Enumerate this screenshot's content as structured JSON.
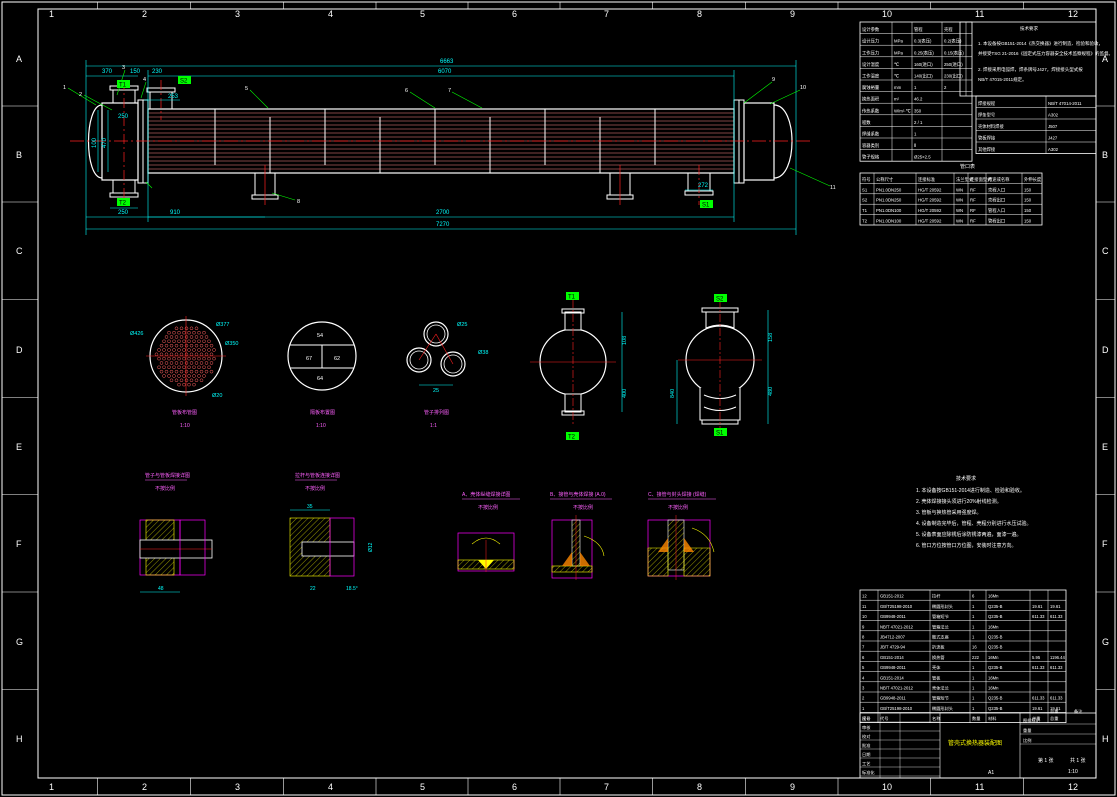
{
  "grid": {
    "columns": [
      "1",
      "2",
      "3",
      "4",
      "5",
      "6",
      "7",
      "8",
      "9",
      "10",
      "11",
      "12"
    ],
    "rows": [
      "A",
      "B",
      "C",
      "D",
      "E",
      "F",
      "G",
      "H"
    ]
  },
  "colors": {
    "background": "#000000",
    "line": "#ffffff",
    "dimension": "#00ffff",
    "centerline": "#ff2020",
    "part": "#ffff00",
    "nozzle_tag": "#00ff00",
    "hatch": "#ff00ff",
    "weld": "#ffff00"
  },
  "nozzles": {
    "t1": "T1",
    "t2": "T2",
    "s1": "S1",
    "s2": "S2"
  },
  "main_view": {
    "dims": {
      "overall_top": "6663",
      "inner_top": "6070",
      "left_a": "370",
      "left_b": "150",
      "left_c": "230",
      "left_d": "253",
      "left_e": "250",
      "height_a": "100",
      "height_b": "470",
      "support": "910",
      "support_span": "2700",
      "overall_bottom": "7270",
      "right_s1": "272"
    },
    "balloons": [
      "1",
      "2",
      "3",
      "4",
      "5",
      "6",
      "7",
      "8",
      "9",
      "10",
      "11"
    ]
  },
  "detail_views": {
    "tubesheet": {
      "caption": "管板布管图",
      "scale": "1:10",
      "d1": "Ø426",
      "d2": "Ø377",
      "d3": "Ø350",
      "d4": "Ø20"
    },
    "passes": {
      "caption": "隔板布置图",
      "scale": "1:10",
      "top": "54",
      "left": "67",
      "right": "62",
      "bottom": "64"
    },
    "tubes": {
      "caption": "管子排列图",
      "scale": "1:1",
      "d1": "Ø25",
      "d2": "Ø38",
      "d3": "25"
    },
    "channel_view": {
      "d1": "108",
      "d2": "400"
    },
    "bonnet_view": {
      "d1": "158",
      "d2": "480",
      "d3": "840"
    }
  },
  "weld_details": {
    "d1": {
      "title": "管子与管板焊接详图",
      "sub": "不按比例",
      "dim": "48"
    },
    "d2": {
      "title": "拉杆与管板连接详图",
      "sub": "不按比例",
      "d1": "35",
      "d2": "Ø12",
      "d3": "18.5°",
      "d4": "22"
    },
    "d3": {
      "title": "A、壳体纵缝焊接详图",
      "sub": "不按比例"
    },
    "d4": {
      "title": "B、接管与壳体焊接 (A.0)",
      "sub": "不按比例"
    },
    "d5": {
      "title": "C、接管与封头焊接 (焊缝)",
      "sub": "不按比例"
    }
  },
  "design_data": {
    "header": [
      "设计参数",
      "",
      "管程",
      "壳程"
    ],
    "rows": [
      [
        "设计压力",
        "MPa",
        "0.3(表压)",
        "0.2(表压)"
      ],
      [
        "工作压力",
        "MPa",
        "0.25(表压)",
        "0.15(表压)"
      ],
      [
        "设计温度",
        "℃",
        "160(进口)",
        "250(进口)"
      ],
      [
        "工作温度",
        "℃",
        "140(出口)",
        "230(出口)"
      ],
      [
        "腐蚀裕量",
        "mm",
        "1",
        "2"
      ],
      [
        "换热面积",
        "m²",
        "46.2",
        ""
      ],
      [
        "传热系数",
        "W/m²·℃",
        "350",
        ""
      ],
      [
        "程数",
        "",
        "2 / 1",
        ""
      ],
      [
        "焊缝系数",
        "",
        "1",
        ""
      ],
      [
        "容器类别",
        "",
        "Ⅱ",
        ""
      ],
      [
        "管子规格",
        "",
        "Ø25×2.5",
        ""
      ]
    ]
  },
  "tech_requirements": {
    "title": "技术要求",
    "lines": [
      "1. 本设备按GB151-2014《热交换器》进行制造、检验和验收，",
      "并接受TSG 21-2016《固定式压力容器安全技术监察规程》的监督。",
      "2. 焊接采用电弧焊，焊条牌号J427，焊接接头型式按",
      "NB/T 47015-2011规定。"
    ],
    "right_block": [
      [
        "焊接规程",
        "NB/T 47014-2011"
      ],
      [
        "焊条型号",
        "A302"
      ],
      [
        "壳体材料焊接",
        "J507"
      ],
      [
        "管板焊接",
        "J427"
      ],
      [
        "其他焊接",
        "A302"
      ]
    ]
  },
  "nozzle_table": {
    "title": "管口表",
    "header": [
      "符号",
      "公称尺寸",
      "连接标准",
      "法兰型式",
      "连接面型式",
      "用途或名称",
      "外伸长度"
    ],
    "rows": [
      [
        "S1",
        "PN1.0DN250",
        "HG/T 20592",
        "WN",
        "RF",
        "壳程入口",
        "150"
      ],
      [
        "S2",
        "PN1.0DN250",
        "HG/T 20592",
        "WN",
        "RF",
        "壳程出口",
        "150"
      ],
      [
        "T1",
        "PN1.0DN100",
        "HG/T 20592",
        "WN",
        "RF",
        "管程入口",
        "150"
      ],
      [
        "T2",
        "PN1.0DN100",
        "HG/T 20592",
        "WN",
        "RF",
        "管程出口",
        "150"
      ]
    ]
  },
  "tech_notes": {
    "title": "技术要求",
    "lines": [
      "1. 本设备按GB151-2014进行制造、检验和验收。",
      "2. 壳体焊接接头须进行20%射线检测。",
      "3. 管板与换热管采用强度焊。",
      "4. 设备制造完毕后，管程、壳程分别进行水压试验。",
      "5. 设备表面应除锈后涂防锈漆两遍，面漆一遍。",
      "6. 管口方位按管口方位图，安装时注意方向。"
    ]
  },
  "bom": {
    "rows": [
      [
        "12",
        "GB151-2012",
        "拉杆",
        "6",
        "16Mn",
        "",
        ""
      ],
      [
        "11",
        "GB/T25198-2010",
        "椭圆形封头",
        "1",
        "Q235-B",
        "19.61",
        "19.61"
      ],
      [
        "10",
        "GB9948-2011",
        "管箱短节",
        "1",
        "Q235-B",
        "611.33",
        "611.33"
      ],
      [
        "9",
        "NB/T 47021-2012",
        "管箱法兰",
        "1",
        "16Mn",
        "",
        ""
      ],
      [
        "8",
        "JB4712-2007",
        "鞍式支座",
        "1",
        "Q235-B",
        "",
        ""
      ],
      [
        "7",
        "JB/T 4729-94",
        "折流板",
        "16",
        "Q235-B",
        "",
        ""
      ],
      [
        "6",
        "GB151-2014",
        "换热管",
        "222",
        "16Mn",
        "5.95",
        "1196.44"
      ],
      [
        "5",
        "GB9948-2011",
        "壳体",
        "1",
        "Q235-B",
        "611.33",
        "611.33"
      ],
      [
        "4",
        "GB151-2014",
        "管板",
        "1",
        "16Mn",
        "",
        ""
      ],
      [
        "3",
        "NB/T 47021-2012",
        "壳体法兰",
        "1",
        "16Mn",
        "",
        ""
      ],
      [
        "2",
        "GB9948-2011",
        "管箱短节",
        "1",
        "Q235-B",
        "611.33",
        "611.33"
      ],
      [
        "1",
        "GB/T25198-2010",
        "椭圆形封头",
        "1",
        "Q235-B",
        "19.61",
        "19.61"
      ]
    ],
    "header": [
      "序号",
      "代号",
      "名称",
      "数量",
      "材料",
      "单重",
      "总重"
    ],
    "header_tail": [
      "总重",
      "备注"
    ]
  },
  "title_block": {
    "drawing_title": "管壳式换热器装配图",
    "left_labels": [
      "设计",
      "审核",
      "校对",
      "批准",
      "日期",
      "工艺",
      "标准化"
    ],
    "right_labels": [
      "图样标记",
      "重量",
      "比例"
    ],
    "sheet": "第 1 张",
    "sheet_total": "共 1 张",
    "scale": "1:10",
    "paper": "A1"
  }
}
